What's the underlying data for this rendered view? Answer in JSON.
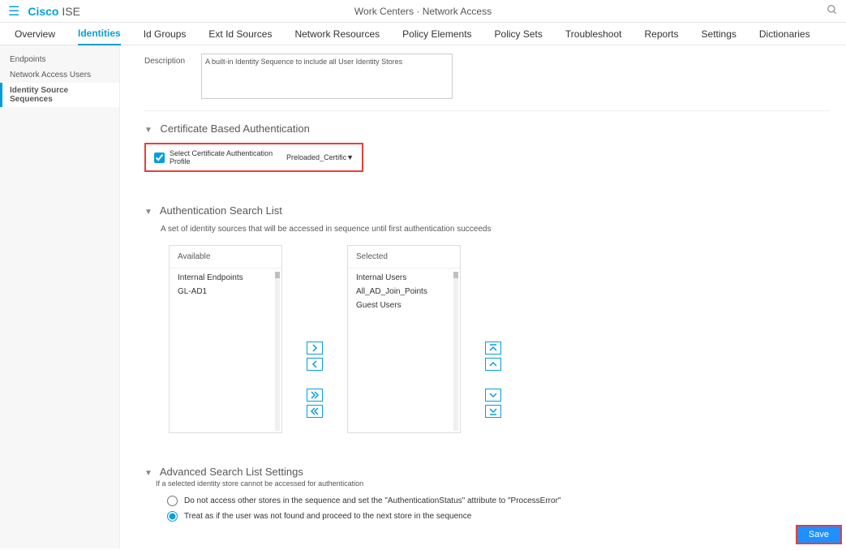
{
  "header": {
    "brand1": "Cisco",
    "brand2": "ISE",
    "breadcrumb": "Work Centers · Network Access"
  },
  "tabs": [
    "Overview",
    "Identities",
    "Id Groups",
    "Ext Id Sources",
    "Network Resources",
    "Policy Elements",
    "Policy Sets",
    "Troubleshoot",
    "Reports",
    "Settings",
    "Dictionaries"
  ],
  "active_tab": 1,
  "sidebar": {
    "items": [
      "Endpoints",
      "Network Access Users",
      "Identity Source Sequences"
    ],
    "active": 2
  },
  "description": {
    "label": "Description",
    "value": "A built-in Identity Sequence to include all User Identity Stores"
  },
  "cert_section": {
    "title": "Certificate Based Authentication",
    "checkbox_label": "Select Certificate Authentication Profile",
    "profile_value": "Preloaded_Certific"
  },
  "auth_section": {
    "title": "Authentication Search List",
    "desc": "A set of identity sources that will be accessed in sequence until first authentication succeeds",
    "available_header": "Available",
    "selected_header": "Selected",
    "available": [
      "Internal Endpoints",
      "GL-AD1"
    ],
    "selected": [
      "Internal Users",
      "All_AD_Join_Points",
      "Guest Users"
    ]
  },
  "adv_section": {
    "title": "Advanced Search List Settings",
    "subtitle": "If a selected identity store cannot be accessed for authentication",
    "option1": "Do not access other stores in the sequence and set the \"AuthenticationStatus\" attribute to \"ProcessError\"",
    "option2": "Treat as if the user was not found and proceed to the next store in the sequence"
  },
  "save_label": "Save"
}
